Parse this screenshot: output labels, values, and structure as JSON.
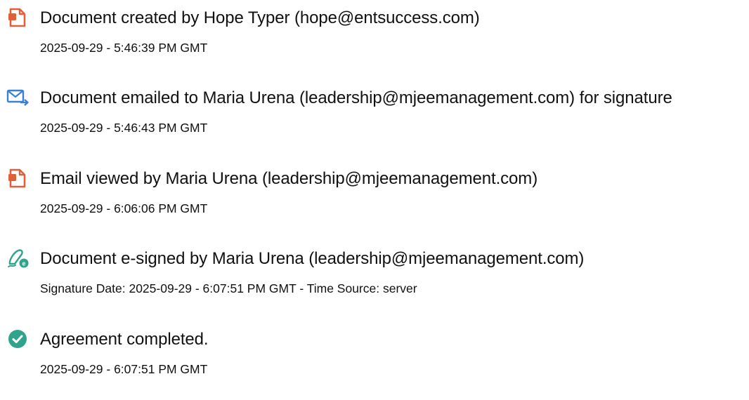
{
  "events": [
    {
      "icon": "document-icon",
      "icon_color": "#E0603A",
      "title": "Document created by Hope Typer (hope@entsuccess.com)",
      "timestamp": "2025-09-29 - 5:46:39 PM GMT"
    },
    {
      "icon": "email-sent-icon",
      "icon_color": "#3B7FD6",
      "title": "Document emailed to Maria Urena (leadership@mjeemanagement.com) for signature",
      "timestamp": "2025-09-29 - 5:46:43 PM GMT"
    },
    {
      "icon": "document-icon",
      "icon_color": "#E0603A",
      "title": "Email viewed by Maria Urena (leadership@mjeemanagement.com)",
      "timestamp": "2025-09-29 - 6:06:06 PM GMT"
    },
    {
      "icon": "esign-pen-icon",
      "icon_color": "#2FA38C",
      "title": "Document e-signed by Maria Urena (leadership@mjeemanagement.com)",
      "timestamp": "Signature Date: 2025-09-29 - 6:07:51 PM GMT - Time Source: server"
    },
    {
      "icon": "check-circle-icon",
      "icon_color": "#2FA38C",
      "title": "Agreement completed.",
      "timestamp": "2025-09-29 - 6:07:51 PM GMT"
    }
  ]
}
